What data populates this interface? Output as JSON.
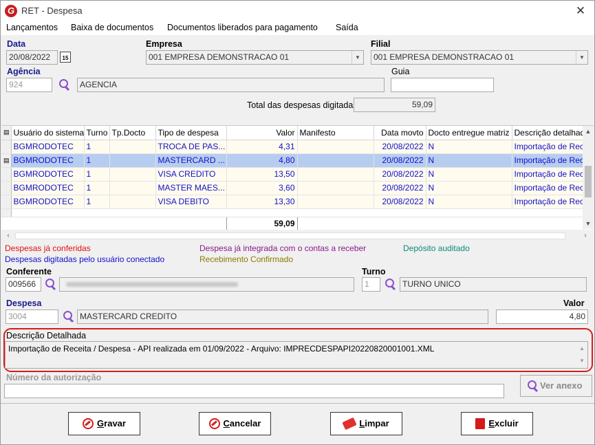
{
  "window": {
    "title": "RET - Despesa",
    "logo_letter": "G"
  },
  "menu": [
    "Lançamentos",
    "Baixa de documentos",
    "Documentos liberados para pagamento",
    "Saída"
  ],
  "form": {
    "data_label": "Data",
    "data_value": "20/08/2022",
    "cal_text": "15",
    "empresa_label": "Empresa",
    "empresa_value": "001 EMPRESA DEMONSTRACAO 01",
    "filial_label": "Filial",
    "filial_value": "001 EMPRESA DEMONSTRACAO 01",
    "agencia_label": "Agência",
    "agencia_code": "924",
    "agencia_name": "AGENCIA",
    "guia_label": "Guia",
    "guia_value": "",
    "total_label": "Total das despesas digitadas",
    "total_value": "59,09"
  },
  "grid": {
    "columns": [
      "Usuário do sistema",
      "Turno",
      "Tp.Docto",
      "Tipo de despesa",
      "Valor",
      "Manifesto",
      "Data movto",
      "Docto entregue matriz",
      "Descrição detalhad"
    ],
    "rows": [
      [
        "BGMRODOTEC",
        "1",
        "",
        "TROCA DE PAS...",
        "4,31",
        "",
        "20/08/2022",
        "N",
        "Importação de Rec"
      ],
      [
        "BGMRODOTEC",
        "1",
        "",
        "MASTERCARD ...",
        "4,80",
        "",
        "20/08/2022",
        "N",
        "Importação de Rec"
      ],
      [
        "BGMRODOTEC",
        "1",
        "",
        "VISA CREDITO",
        "13,50",
        "",
        "20/08/2022",
        "N",
        "Importação de Rec"
      ],
      [
        "BGMRODOTEC",
        "1",
        "",
        "MASTER MAES...",
        "3,60",
        "",
        "20/08/2022",
        "N",
        "Importação de Rec"
      ],
      [
        "BGMRODOTEC",
        "1",
        "",
        "VISA DEBITO",
        "13,30",
        "",
        "20/08/2022",
        "N",
        "Importação de Rec"
      ]
    ],
    "total": "59,09"
  },
  "legend": {
    "conferidas": "Despesas já conferidas",
    "usuario": "Despesas digitadas pelo usuário conectado",
    "integrada": "Despesa já integrada com o contas a receber",
    "recebimento": "Recebimento Confirmado",
    "deposito": "Depósito auditado"
  },
  "legend_colors": {
    "conferidas": "#e01010",
    "usuario": "#1010c8",
    "integrada": "#8a1a8a",
    "recebimento": "#8a7a00",
    "deposito": "#0a8a7a"
  },
  "detail": {
    "conferente_label": "Conferente",
    "conferente_code": "009566",
    "turno_label": "Turno",
    "turno_code": "1",
    "turno_name": "TURNO UNICO",
    "despesa_label": "Despesa",
    "despesa_code": "3004",
    "despesa_name": "MASTERCARD CREDITO",
    "valor_label": "Valor",
    "valor_value": "4,80",
    "descricao_label": "Descrição Detalhada",
    "descricao_value": "Importação de Receita / Despesa - API realizada em 01/09/2022 - Arquivo: IMPRECDESPAPI20220820001001.XML",
    "autorizacao_label": "Número da autorização",
    "autorizacao_value": "",
    "ver_anexo": "Ver anexo"
  },
  "buttons": {
    "gravar_first": "G",
    "gravar_rest": "ravar",
    "cancelar_first": "C",
    "cancelar_rest": "ancelar",
    "limpar_first": "L",
    "limpar_rest": "impar",
    "excluir_first": "E",
    "excluir_rest": "xcluir"
  }
}
